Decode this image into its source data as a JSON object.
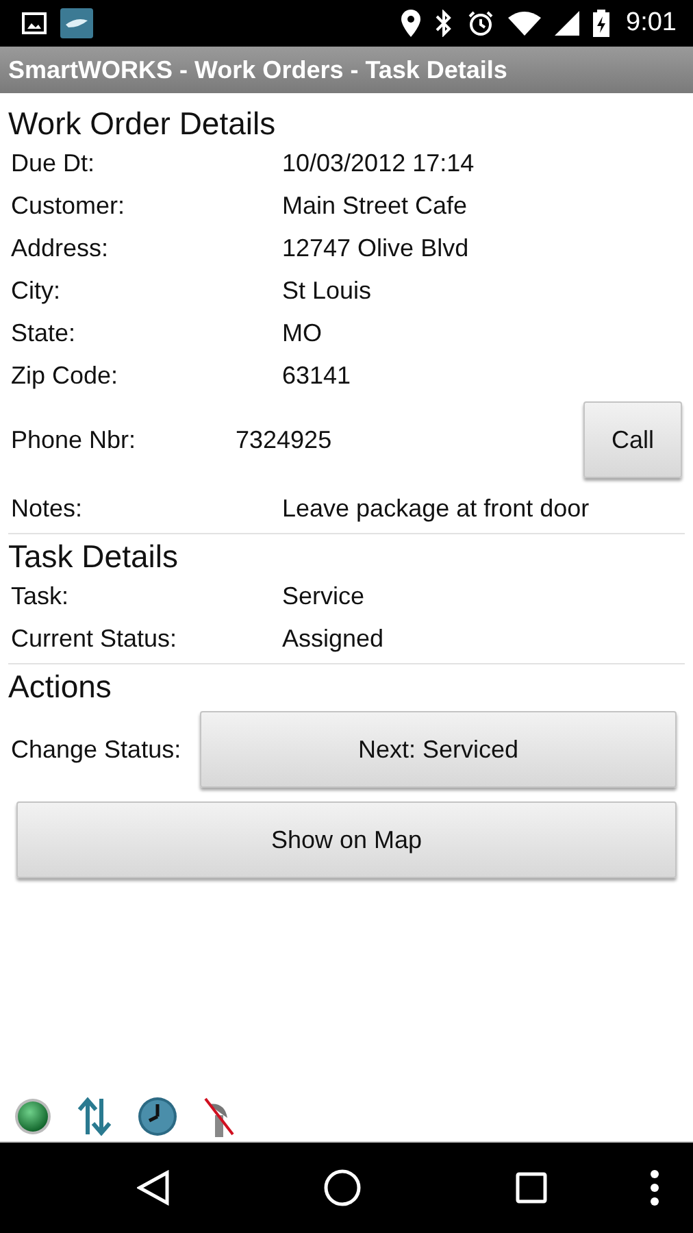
{
  "status_bar": {
    "time": "9:01"
  },
  "title_bar": {
    "title": "SmartWORKS - Work Orders - Task Details"
  },
  "work_order": {
    "heading": "Work Order Details",
    "fields": [
      {
        "label": "Due Dt:",
        "value": "10/03/2012 17:14"
      },
      {
        "label": "Customer:",
        "value": "Main Street Cafe"
      },
      {
        "label": "Address:",
        "value": "12747 Olive Blvd"
      },
      {
        "label": "City:",
        "value": "St Louis"
      },
      {
        "label": "State:",
        "value": "MO"
      },
      {
        "label": "Zip Code:",
        "value": "63141"
      }
    ],
    "phone": {
      "label": "Phone Nbr:",
      "value": "7324925",
      "button": "Call"
    },
    "notes": {
      "label": "Notes:",
      "value": "Leave package at front door"
    }
  },
  "task": {
    "heading": "Task Details",
    "fields": [
      {
        "label": "Task:",
        "value": "Service"
      },
      {
        "label": "Current Status:",
        "value": "Assigned"
      }
    ]
  },
  "actions": {
    "heading": "Actions",
    "change_status_label": "Change Status:",
    "next_button": "Next: Serviced",
    "map_button": "Show on Map"
  }
}
